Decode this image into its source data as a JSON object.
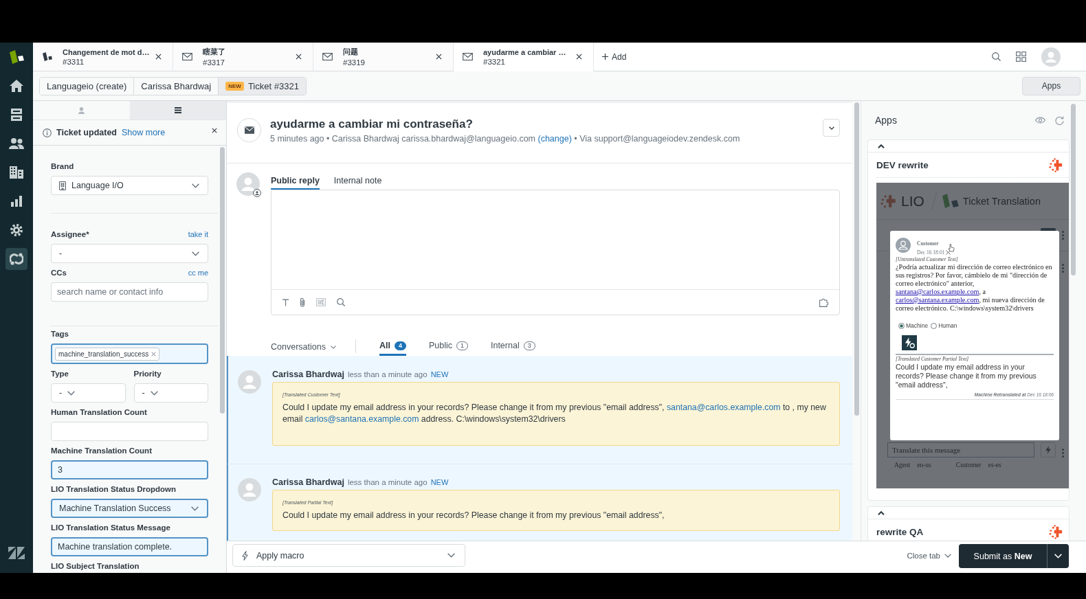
{
  "nav": {
    "items": [
      {
        "selected": false
      },
      {
        "selected": false
      },
      {
        "selected": false
      },
      {
        "selected": false
      },
      {
        "selected": false
      },
      {
        "selected": false
      },
      {
        "selected": true
      }
    ]
  },
  "tabs": [
    {
      "kind": "web",
      "title": "Changement de mot d…",
      "number": "#3311",
      "selected": false
    },
    {
      "kind": "email",
      "title": "瞎菜了",
      "number": "#3317",
      "selected": false
    },
    {
      "kind": "email",
      "title": "问题",
      "number": "#3319",
      "selected": false
    },
    {
      "kind": "email",
      "title": "ayudarme a cambiar …",
      "number": "#3321",
      "selected": true
    }
  ],
  "add_tab": "Add",
  "breadcrumbs": [
    {
      "label": "Languageio (create)",
      "selected": false
    },
    {
      "label": "Carissa Bhardwaj",
      "selected": false
    },
    {
      "label": "Ticket #3321",
      "badge": "NEW",
      "selected": true
    }
  ],
  "apps_button": "Apps",
  "ticket_panel": {
    "side_tabs": [
      {
        "selected": false
      },
      {
        "selected": true
      }
    ],
    "notice": {
      "title": "Ticket updated",
      "link": "Show more"
    },
    "sections": [
      {
        "fields": [
          {
            "kind": "brand",
            "label": "Brand",
            "value": "Language I/O",
            "changed": false
          }
        ]
      },
      {
        "fields": [
          {
            "kind": "select",
            "label": "Assignee*",
            "action": "take it",
            "value": "-",
            "changed": false
          },
          {
            "kind": "input",
            "label": "CCs",
            "action": "cc me",
            "placeholder": "search name or contact info",
            "changed": false
          }
        ]
      },
      {
        "fields": [
          {
            "kind": "tags",
            "label": "Tags",
            "tags": [
              "machine_translation_success"
            ],
            "changed": true
          },
          {
            "kind": "pair",
            "items": [
              {
                "label": "Type",
                "value": "-",
                "changed": false
              },
              {
                "label": "Priority",
                "value": "-",
                "changed": false
              }
            ]
          },
          {
            "kind": "input",
            "label": "Human Translation Count",
            "changed": false
          },
          {
            "kind": "input",
            "label": "Machine Translation Count",
            "value": "3",
            "changed": true
          },
          {
            "kind": "select",
            "label": "LIO Translation Status Dropdown",
            "value": "Machine Translation Success",
            "changed": true
          },
          {
            "kind": "input",
            "label": "LIO Translation Status Message",
            "value": "Machine translation complete.",
            "changed": true
          },
          {
            "kind": "label",
            "label": "LIO Subject Translation"
          }
        ]
      }
    ]
  },
  "ticket": {
    "subject": "ayudarme a cambiar mi contraseña?",
    "meta_before": "5 minutes ago • Carissa Bhardwaj carissa.bhardwaj@languageio.com",
    "meta_link": "(change)",
    "meta_after": "• Via support@languageiodev.zendesk.com"
  },
  "reply": {
    "tabs": [
      {
        "label": "Public reply",
        "selected": true
      },
      {
        "label": "Internal note",
        "selected": false
      }
    ]
  },
  "conversations": {
    "filter": "Conversations",
    "tabs": [
      {
        "label": "All",
        "count": "4",
        "selected": true
      },
      {
        "label": "Public",
        "count": "1",
        "selected": false
      },
      {
        "label": "Internal",
        "count": "3",
        "selected": false
      }
    ],
    "messages": [
      {
        "author": "Carissa Bhardwaj",
        "time": "less than a minute ago",
        "badge": "NEW",
        "highlighted": true,
        "note_label": "[Translated Customer Text]",
        "body": [
          {
            "kind": "text",
            "text": "Could I update my email address in your records? Please change it from my previous \"email address\", "
          },
          {
            "kind": "link",
            "text": "santana@carlos.example.com"
          },
          {
            "kind": "text",
            "text": " to , my new email "
          },
          {
            "kind": "link",
            "text": "carlos@santana.example.com"
          },
          {
            "kind": "text",
            "text": " address. C:\\windows\\system32\\drivers"
          }
        ]
      },
      {
        "author": "Carissa Bhardwaj",
        "time": "less than a minute ago",
        "badge": "NEW",
        "highlighted": true,
        "note_label": "[Translated Partial Text]",
        "body": [
          {
            "kind": "text",
            "text": "Could I update my email address in your records? Please change it from my previous \"email address\","
          }
        ]
      }
    ]
  },
  "footer": {
    "macro_placeholder": "Apply macro",
    "close_tab": "Close tab",
    "submit": "Submit as **New**"
  },
  "apps_panel": {
    "title": "Apps",
    "cards": [
      {
        "title": "DEV rewrite",
        "expanded": true,
        "app": {
          "brand": "LIO",
          "title": "Ticket Translation",
          "placeholder": "Translate this message",
          "languages": [
            {
              "label": "Agent",
              "value": "en-us"
            },
            {
              "label": "Customer",
              "value": "es-es"
            }
          ],
          "dialog": {
            "author": "Customer",
            "time": "Dec 16 18:01",
            "source_label": "[Untranslated Customer Text]",
            "source_body": [
              {
                "kind": "text",
                "text": "¿Podría actualizar mi dirección de correo electrónico en sus registros? Por favor, cámbielo de mi \"dirección de correo electrónico\" anterior, "
              },
              {
                "kind": "link",
                "text": "santana@carlos.example.com"
              },
              {
                "kind": "text",
                "text": ", a "
              },
              {
                "kind": "link",
                "text": "carlos@santana.example.com"
              },
              {
                "kind": "text",
                "text": ", mi nueva dirección de correo electrónico. C:\\windows\\system32\\drivers"
              }
            ],
            "modes": [
              {
                "label": "Machine",
                "selected": true
              },
              {
                "label": "Human",
                "selected": false
              }
            ],
            "target_label": "[Translated Customer Partial Text]",
            "target_text": "Could I update my email address in your records? Please change it from my previous \"email address\",",
            "footer": "**Machine Retranslated at** Dec 16 18:06"
          }
        }
      },
      {
        "title": "rewrite QA",
        "expanded": true
      }
    ]
  }
}
